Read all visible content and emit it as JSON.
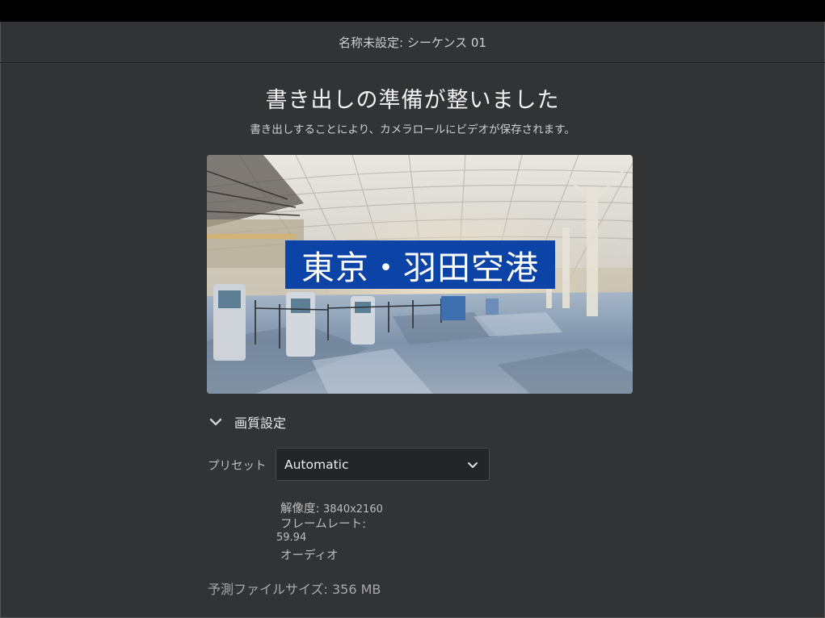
{
  "window": {
    "title": "名称未設定: シーケンス 01"
  },
  "main": {
    "heading": "書き出しの準備が整いました",
    "subheading": "書き出しすることにより、カメラロールにビデオが保存されます。",
    "preview": {
      "overlay_title": "東京・羽田空港",
      "overlay_color": "#0b43a6"
    }
  },
  "quality_section": {
    "label": "画質設定",
    "expanded": true,
    "preset_label": "プリセット",
    "preset_value": "Automatic",
    "resolution_label": "解像度: ",
    "resolution_value": "3840x2160",
    "framerate_label": "フレームレート:",
    "framerate_value": "59.94",
    "audio_label": "オーディオ"
  },
  "footer": {
    "filesize_label": "予測ファイルサイズ: ",
    "filesize_value": "356 MB"
  },
  "icons": {
    "section_toggle": "chevron-down-icon",
    "preset_dropdown": "chevron-down-icon"
  },
  "colors": {
    "background": "#323335",
    "topbar": "#000000",
    "accent": "#0b43a6"
  }
}
